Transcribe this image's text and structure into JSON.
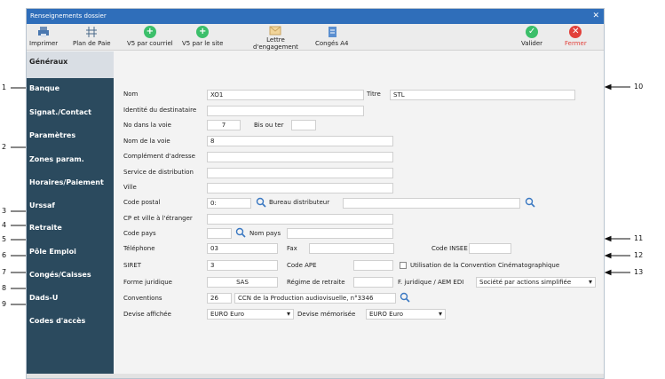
{
  "window": {
    "title": "Renseignements dossier",
    "close": "✕"
  },
  "toolbar": {
    "print": "Imprimer",
    "plan": "Plan de Paie",
    "v5_mail": "V5 par courriel",
    "v5_site": "V5 par le site",
    "lettre_1": "Lettre",
    "lettre_2": "d'engagement",
    "conges": "Congés A4",
    "valider": "Valider",
    "fermer": "Fermer"
  },
  "sidebar": [
    "Généraux",
    "Banque",
    "Signat./Contact",
    "Paramètres",
    "Zones param.",
    "Horaires/Paiement",
    "Urssaf",
    "Retraite",
    "Pôle Emploi",
    "Congés/Caisses",
    "Dads-U",
    "Codes d'accès"
  ],
  "form": {
    "nom_label": "Nom",
    "nom_value": "XO1",
    "titre_label": "Titre",
    "titre_value": "STL",
    "identite_label": "Identité du destinataire",
    "no_voie_label": "No dans la voie",
    "no_voie_value": "7",
    "bis_label": "Bis ou ter",
    "nom_voie_label": "Nom de la voie",
    "nom_voie_value": "8",
    "complement_label": "Complément d'adresse",
    "service_label": "Service de distribution",
    "ville_label": "Ville",
    "cp_label": "Code postal",
    "cp_value": "0:",
    "bureau_label": "Bureau distributeur",
    "cp_etranger_label": "CP et ville à l'étranger",
    "code_pays_label": "Code pays",
    "nom_pays_label": "Nom pays",
    "telephone_label": "Téléphone",
    "telephone_value": "03",
    "fax_label": "Fax",
    "insee_label": "Code INSEE",
    "siret_label": "SIRET",
    "siret_value": "3",
    "ape_label": "Code APE",
    "convention_cine_label": "Utilisation de la Convention Cinématographique",
    "forme_label": "Forme juridique",
    "forme_value": "SAS",
    "regime_label": "Régime de retraite",
    "fjuridique_label": "F. juridique / AEM EDI",
    "fjuridique_value": "Société par actions simplifiée",
    "conventions_label": "Conventions",
    "conventions_code": "26",
    "conventions_value": "CCN de la Production audiovisuelle, n°3346",
    "devise_aff_label": "Devise affichée",
    "devise_aff_value": "EURO Euro",
    "devise_mem_label": "Devise mémorisée",
    "devise_mem_value": "EURO Euro"
  },
  "callouts": [
    "1",
    "2",
    "3",
    "4",
    "5",
    "6",
    "7",
    "8",
    "9",
    "10",
    "11",
    "12",
    "13"
  ],
  "colors": {
    "titlebar": "#2f6eba",
    "sidebar": "#2b4a5e",
    "green": "#3cbf6a",
    "red": "#e2403a"
  }
}
